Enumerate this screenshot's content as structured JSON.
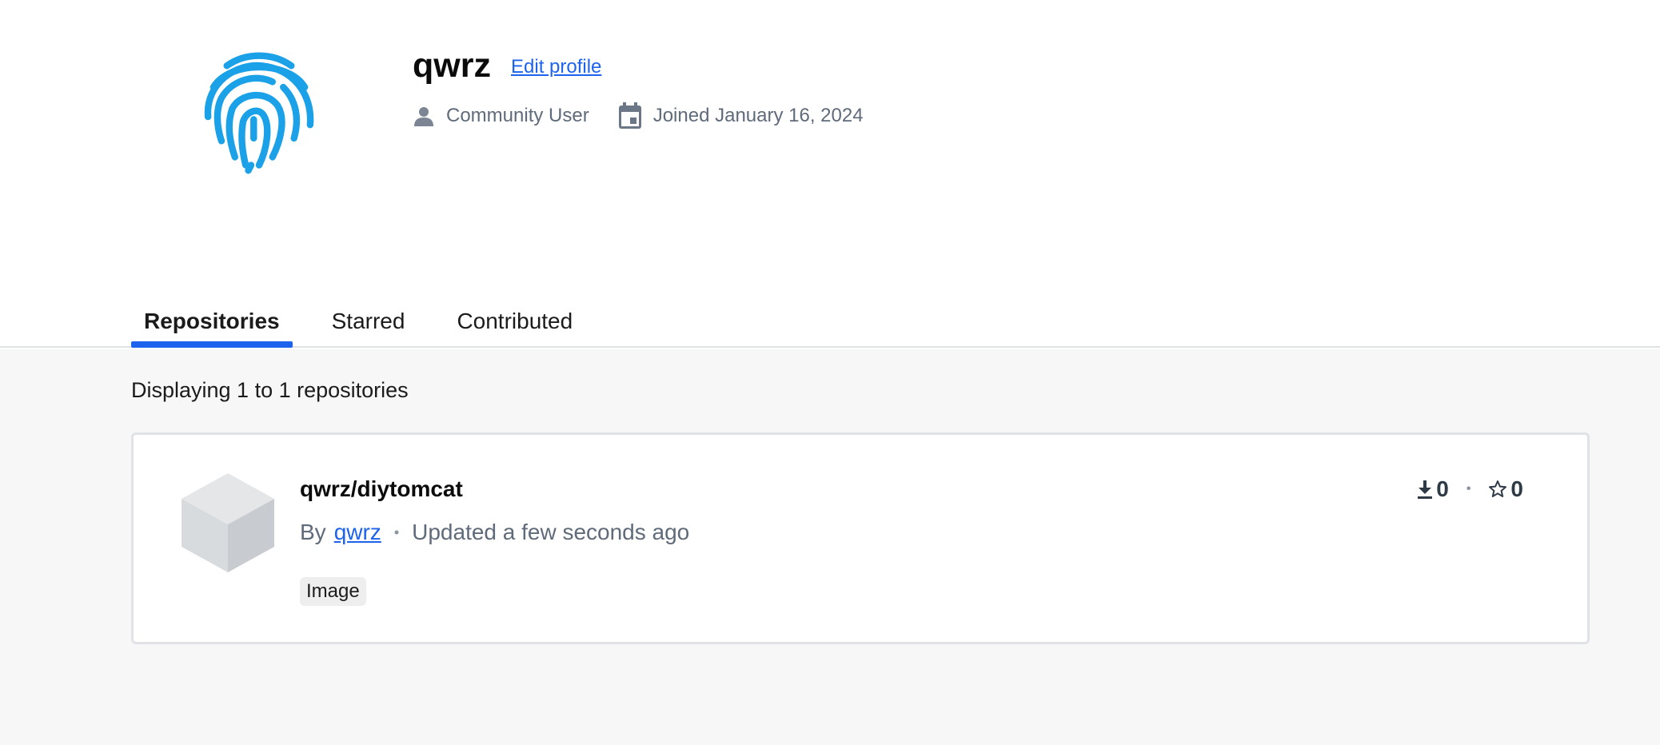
{
  "profile": {
    "username": "qwrz",
    "edit_label": "Edit profile",
    "role": "Community User",
    "joined": "Joined January 16, 2024",
    "avatar_icon": "fingerprint-icon",
    "avatar_color": "#1ba1e8"
  },
  "tabs": [
    {
      "label": "Repositories",
      "active": true
    },
    {
      "label": "Starred",
      "active": false
    },
    {
      "label": "Contributed",
      "active": false
    }
  ],
  "results": {
    "count_text": "Displaying 1 to 1 repositories"
  },
  "repositories": [
    {
      "name": "qwrz/diytomcat",
      "by_prefix": "By",
      "owner": "qwrz",
      "separator": "•",
      "updated": "Updated a few seconds ago",
      "badge": "Image",
      "downloads": "0",
      "stars": "0",
      "stat_separator": "•",
      "icon": "cube-icon"
    }
  ],
  "colors": {
    "accent": "#1d63ed",
    "muted_text": "#5f6b7a",
    "background": "#f7f7f7"
  }
}
